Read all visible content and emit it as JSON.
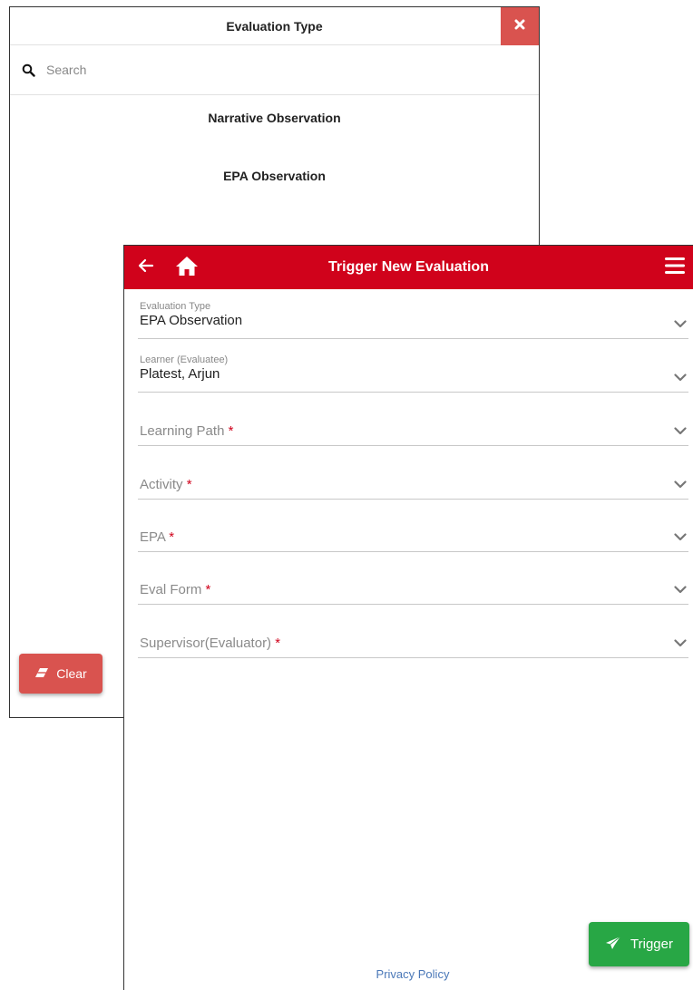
{
  "picker": {
    "title": "Evaluation Type",
    "close_icon": "close-icon",
    "search_icon": "search-icon",
    "search_placeholder": "Search",
    "options": [
      "Narrative Observation",
      "EPA Observation"
    ],
    "clear_label": "Clear",
    "clear_icon": "eraser-icon"
  },
  "app_bar": {
    "title": "Trigger New Evaluation",
    "back_icon": "arrow-left-icon",
    "home_icon": "home-icon",
    "menu_icon": "hamburger-menu-icon",
    "color": "#d0021b"
  },
  "form": {
    "evaluation_type": {
      "label": "Evaluation Type",
      "value": "EPA Observation"
    },
    "learner": {
      "label": "Learner (Evaluatee)",
      "value": "Platest, Arjun"
    },
    "learning_path": {
      "placeholder": "Learning Path",
      "required_mark": "*"
    },
    "activity": {
      "placeholder": "Activity",
      "required_mark": "*"
    },
    "epa": {
      "placeholder": "EPA",
      "required_mark": "*"
    },
    "eval_form": {
      "placeholder": "Eval Form",
      "required_mark": "*"
    },
    "supervisor": {
      "placeholder": "Supervisor(Evaluator)",
      "required_mark": "*"
    }
  },
  "trigger": {
    "label": "Trigger",
    "icon": "paper-plane-icon",
    "color": "#28a745"
  },
  "footer": {
    "privacy_label": "Privacy Policy"
  }
}
